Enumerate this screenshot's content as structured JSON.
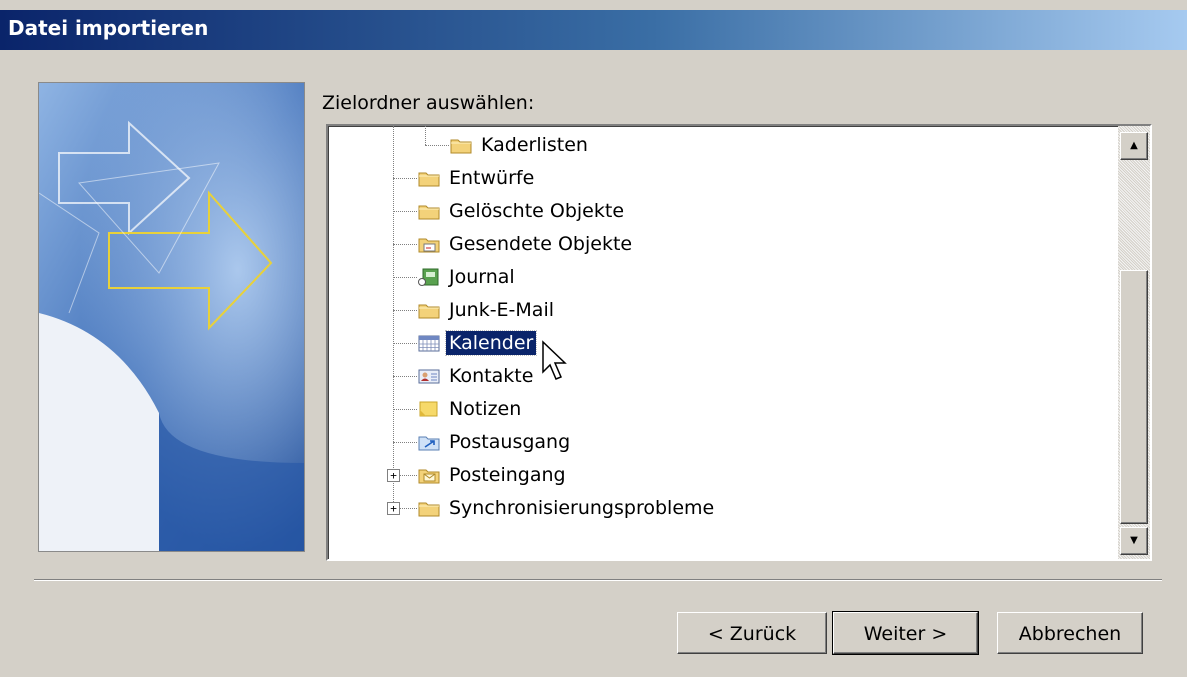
{
  "window": {
    "title": "Datei importieren"
  },
  "prompt": "Zielordner auswählen:",
  "tree": {
    "items": [
      {
        "label": "Kaderlisten",
        "icon": "folder-icon",
        "depth": 2,
        "selected": false,
        "expandable": false
      },
      {
        "label": "Entwürfe",
        "icon": "folder-icon",
        "depth": 1,
        "selected": false,
        "expandable": false
      },
      {
        "label": "Gelöschte Objekte",
        "icon": "folder-icon",
        "depth": 1,
        "selected": false,
        "expandable": false
      },
      {
        "label": "Gesendete Objekte",
        "icon": "sent-items-icon",
        "depth": 1,
        "selected": false,
        "expandable": false
      },
      {
        "label": "Journal",
        "icon": "journal-icon",
        "depth": 1,
        "selected": false,
        "expandable": false
      },
      {
        "label": "Junk-E-Mail",
        "icon": "folder-icon",
        "depth": 1,
        "selected": false,
        "expandable": false
      },
      {
        "label": "Kalender",
        "icon": "calendar-icon",
        "depth": 1,
        "selected": true,
        "expandable": false
      },
      {
        "label": "Kontakte",
        "icon": "contacts-icon",
        "depth": 1,
        "selected": false,
        "expandable": false
      },
      {
        "label": "Notizen",
        "icon": "notes-icon",
        "depth": 1,
        "selected": false,
        "expandable": false
      },
      {
        "label": "Postausgang",
        "icon": "outbox-icon",
        "depth": 1,
        "selected": false,
        "expandable": false
      },
      {
        "label": "Posteingang",
        "icon": "inbox-icon",
        "depth": 1,
        "selected": false,
        "expandable": true
      },
      {
        "label": "Synchronisierungsprobleme",
        "icon": "folder-icon",
        "depth": 1,
        "selected": false,
        "expandable": true
      }
    ]
  },
  "buttons": {
    "back": "< Zurück",
    "next": "Weiter >",
    "cancel": "Abbrechen"
  },
  "colors": {
    "selection": "#0a246a",
    "dialog_bg": "#d4d0c8",
    "titlebar_start": "#0a246a",
    "titlebar_end": "#a6caf0"
  }
}
